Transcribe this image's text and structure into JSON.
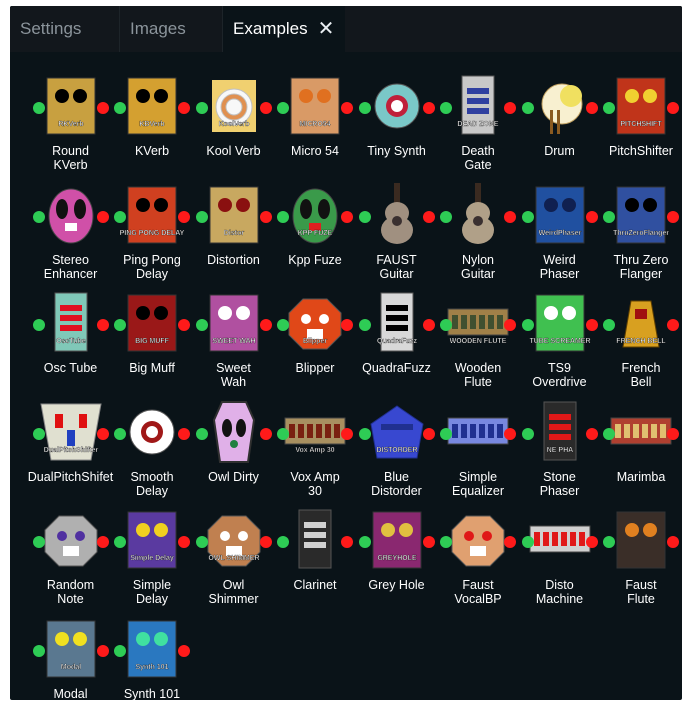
{
  "tabs": [
    {
      "label": "Settings",
      "active": false
    },
    {
      "label": "Images",
      "active": false
    },
    {
      "label": "Examples",
      "active": true,
      "close_icon": "close-icon"
    }
  ],
  "colors": {
    "panel_bg": "#0a1318",
    "tabbar_bg": "#12171c",
    "active_tab_text": "#ffffff",
    "inactive_tab_text": "#8b949b",
    "port_in": "#2ecc55",
    "port_out": "#ff1a1a"
  },
  "examples": [
    {
      "label": "Round\nKVerb",
      "name": "round-kverb",
      "thumb_text": "RKVerb",
      "color": "#c8a040",
      "shape": "rect",
      "accent": "#000000"
    },
    {
      "label": "KVerb",
      "name": "kverb",
      "thumb_text": "KBVerb",
      "color": "#d4a030",
      "shape": "rect",
      "accent": "#000000"
    },
    {
      "label": "Kool Verb",
      "name": "kool-verb",
      "thumb_text": "KoolVerb",
      "color": "#f0d070",
      "shape": "circle-rect",
      "accent": "#ffffff"
    },
    {
      "label": "Micro 54",
      "name": "micro-54",
      "thumb_text": "MICRO54",
      "color": "#d99a66",
      "shape": "rect",
      "accent": "#e07020"
    },
    {
      "label": "Tiny Synth",
      "name": "tiny-synth",
      "thumb_text": "",
      "color": "#7ac8c8",
      "shape": "circle",
      "accent": "#c0203a"
    },
    {
      "label": "Death\nGate",
      "name": "death-gate",
      "thumb_text": "DEAD ZONE",
      "color": "#c8c8c8",
      "shape": "tall",
      "accent": "#3040a0"
    },
    {
      "label": "Drum",
      "name": "drum",
      "thumb_text": "",
      "color": "#e8d0a0",
      "shape": "drum",
      "accent": "#f0e060"
    },
    {
      "label": "PitchShifter",
      "name": "pitchshifter",
      "thumb_text": "PITCHSHIFT",
      "color": "#c0341a",
      "shape": "rect",
      "accent": "#f0d030"
    },
    {
      "label": "Stereo\nEnhancer",
      "name": "stereo-enhancer",
      "thumb_text": "",
      "color": "#d050a8",
      "shape": "egg",
      "accent": "#ffffff"
    },
    {
      "label": "Ping Pong\nDelay",
      "name": "ping-pong-delay",
      "thumb_text": "PING PONG DELAY",
      "color": "#d04020",
      "shape": "rect",
      "accent": "#000000"
    },
    {
      "label": "Distortion",
      "name": "distortion",
      "thumb_text": "Distor",
      "color": "#c8a860",
      "shape": "rect",
      "accent": "#8a1010"
    },
    {
      "label": "Kpp Fuze",
      "name": "kpp-fuze",
      "thumb_text": "KPP FUZE",
      "color": "#3a9a4a",
      "shape": "egg",
      "accent": "#e02020"
    },
    {
      "label": "FAUST\nGuitar",
      "name": "faust-guitar",
      "thumb_text": "",
      "color": "#a09080",
      "shape": "guitar",
      "accent": "#3a3030"
    },
    {
      "label": "Nylon\nGuitar",
      "name": "nylon-guitar",
      "thumb_text": "",
      "color": "#b0a088",
      "shape": "guitar",
      "accent": "#3a3030"
    },
    {
      "label": "Weird\nPhaser",
      "name": "weird-phaser",
      "thumb_text": "WeirdPhaser",
      "color": "#2050a0",
      "shape": "rect",
      "accent": "#102050"
    },
    {
      "label": "Thru Zero\nFlanger",
      "name": "thru-zero-flanger",
      "thumb_text": "ThruZeroFlanger",
      "color": "#3050a0",
      "shape": "rect",
      "accent": "#000000"
    },
    {
      "label": "Osc Tube",
      "name": "osc-tube",
      "thumb_text": "OscTube",
      "color": "#80c8b8",
      "shape": "tall",
      "accent": "#e01020"
    },
    {
      "label": "Big Muff",
      "name": "big-muff",
      "thumb_text": "BIG MUFF",
      "color": "#9a1818",
      "shape": "rect",
      "accent": "#000000"
    },
    {
      "label": "Sweet\nWah",
      "name": "sweet-wah",
      "thumb_text": "SWEET WAH",
      "color": "#b050a0",
      "shape": "rect",
      "accent": "#ffffff"
    },
    {
      "label": "Blipper",
      "name": "blipper",
      "thumb_text": "Blipper",
      "color": "#e04818",
      "shape": "octagon",
      "accent": "#ffffff"
    },
    {
      "label": "QuadraFuzz",
      "name": "quadrafuzz",
      "thumb_text": "QuadraFuzz",
      "color": "#d8d8d8",
      "shape": "tall",
      "accent": "#000000"
    },
    {
      "label": "Wooden\nFlute",
      "name": "wooden-flute",
      "thumb_text": "WOODEN FLUTE",
      "color": "#a08048",
      "shape": "wide",
      "accent": "#405030"
    },
    {
      "label": "TS9\nOverdrive",
      "name": "ts9-overdrive",
      "thumb_text": "TUBE SCREAMER",
      "color": "#40c050",
      "shape": "rect",
      "accent": "#ffffff"
    },
    {
      "label": "French\nBell",
      "name": "french-bell",
      "thumb_text": "FRENCH BELL",
      "color": "#d8a020",
      "shape": "bell",
      "accent": "#a01010"
    },
    {
      "label": "DualPitchShifet",
      "name": "dualpitchshifet",
      "thumb_text": "DualPitchShifter",
      "color": "#e0e0d0",
      "shape": "trapezoid",
      "accent": "#2040c0"
    },
    {
      "label": "Smooth\nDelay",
      "name": "smooth-delay",
      "thumb_text": "",
      "color": "#ffffff",
      "shape": "circle",
      "accent": "#a01818"
    },
    {
      "label": "Owl Dirty",
      "name": "owl-dirty",
      "thumb_text": "",
      "color": "#e0b0e8",
      "shape": "coffin",
      "accent": "#208040"
    },
    {
      "label": "Vox Amp\n30",
      "name": "vox-amp-30",
      "thumb_text": "Vox Amp 30",
      "color": "#a89060",
      "shape": "wide",
      "accent": "#7a2010"
    },
    {
      "label": "Blue\nDistorder",
      "name": "blue-distorder",
      "thumb_text": "DISTORDER",
      "color": "#3848d0",
      "shape": "pentagon",
      "accent": "#ffffff"
    },
    {
      "label": "Simple\nEqualizer",
      "name": "simple-equalizer",
      "thumb_text": "",
      "color": "#7888e0",
      "shape": "wide",
      "accent": "#203090"
    },
    {
      "label": "Stone\nPhaser",
      "name": "stone-phaser",
      "thumb_text": "NE PHA",
      "color": "#2a2a2a",
      "shape": "tall",
      "accent": "#e01818"
    },
    {
      "label": "Marimba",
      "name": "marimba",
      "thumb_text": "",
      "color": "#b04030",
      "shape": "wide",
      "accent": "#e0c070"
    },
    {
      "label": "Random\nNote",
      "name": "random-note",
      "thumb_text": "",
      "color": "#b0b0b0",
      "shape": "octagon",
      "accent": "#5030a0"
    },
    {
      "label": "Simple\nDelay",
      "name": "simple-delay",
      "thumb_text": "Simple Delay",
      "color": "#5a3aa0",
      "shape": "rect",
      "accent": "#f0d020"
    },
    {
      "label": "Owl\nShimmer",
      "name": "owl-shimmer",
      "thumb_text": "OWL SHIMMER",
      "color": "#c08050",
      "shape": "octagon",
      "accent": "#ffffff"
    },
    {
      "label": "Clarinet",
      "name": "clarinet",
      "thumb_text": "",
      "color": "#2a2a2a",
      "shape": "tall",
      "accent": "#d0d0d0"
    },
    {
      "label": "Grey Hole",
      "name": "grey-hole",
      "thumb_text": "GREYHOLE",
      "color": "#8a2870",
      "shape": "rect",
      "accent": "#e0c040"
    },
    {
      "label": "Faust\nVocalBP",
      "name": "faust-vocalbp",
      "thumb_text": "",
      "color": "#e0a070",
      "shape": "octagon",
      "accent": "#e01818"
    },
    {
      "label": "Disto\nMachine",
      "name": "disto-machine",
      "thumb_text": "",
      "color": "#d0d0d0",
      "shape": "wide",
      "accent": "#e01818"
    },
    {
      "label": "Faust\nFlute",
      "name": "faust-flute",
      "thumb_text": "",
      "color": "#3a2e28",
      "shape": "rect",
      "accent": "#e08020"
    },
    {
      "label": "Modal",
      "name": "modal",
      "thumb_text": "Modal",
      "color": "#5a7890",
      "shape": "rect",
      "accent": "#f0e020"
    },
    {
      "label": "Synth 101",
      "name": "synth-101",
      "thumb_text": "Synth 101",
      "color": "#2a78c0",
      "shape": "rect",
      "accent": "#40e0a0"
    }
  ]
}
